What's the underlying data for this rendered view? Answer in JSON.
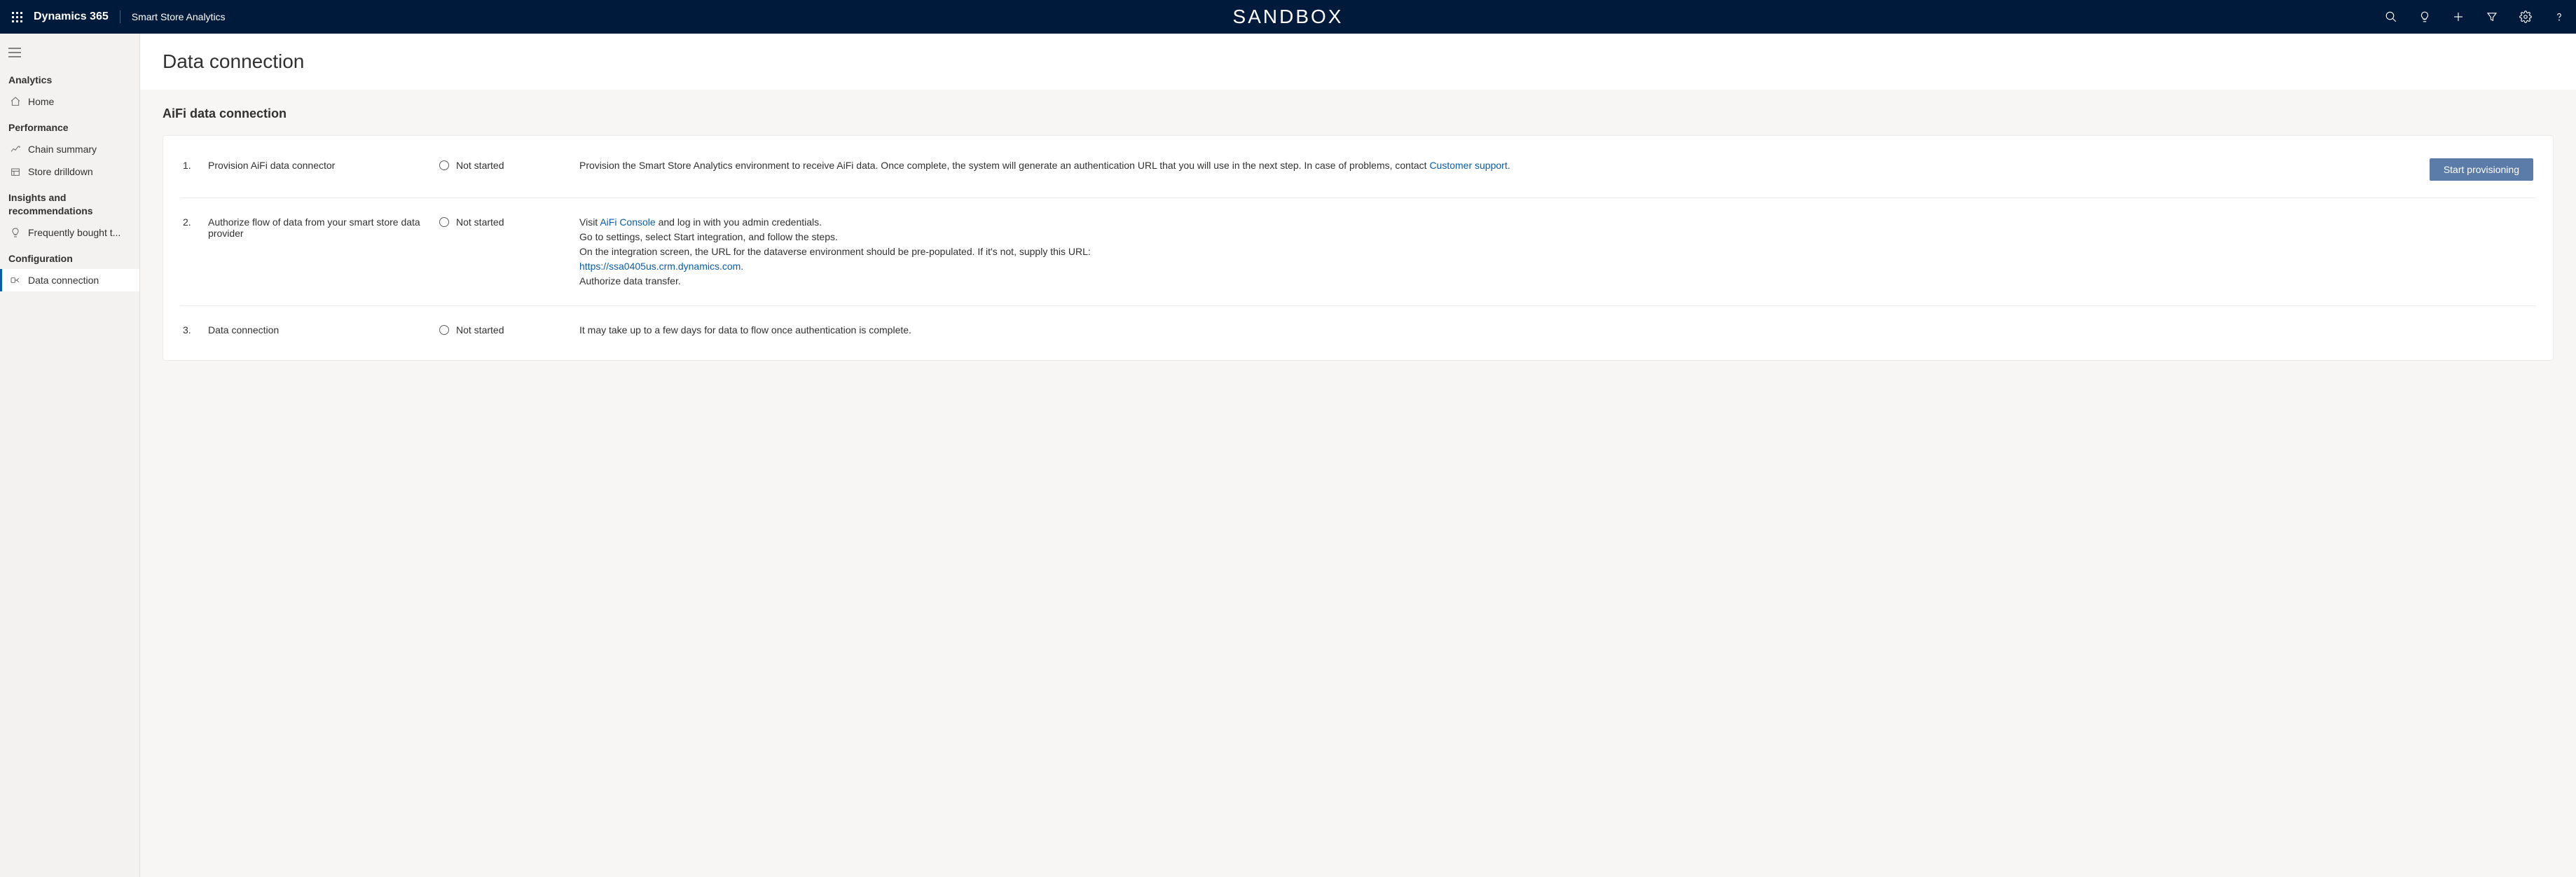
{
  "header": {
    "brand": "Dynamics 365",
    "app_name": "Smart Store Analytics",
    "env_label": "SANDBOX"
  },
  "sidebar": {
    "sections": [
      {
        "title": "Analytics",
        "items": [
          {
            "label": "Home",
            "icon": "home",
            "name": "sidebar-item-home"
          }
        ]
      },
      {
        "title": "Performance",
        "items": [
          {
            "label": "Chain summary",
            "icon": "chart-line",
            "name": "sidebar-item-chain-summary"
          },
          {
            "label": "Store drilldown",
            "icon": "store",
            "name": "sidebar-item-store-drilldown"
          }
        ]
      },
      {
        "title": "Insights and recommendations",
        "items": [
          {
            "label": "Frequently bought t...",
            "icon": "lightbulb",
            "name": "sidebar-item-frequently-bought"
          }
        ]
      },
      {
        "title": "Configuration",
        "items": [
          {
            "label": "Data connection",
            "icon": "connection",
            "name": "sidebar-item-data-connection",
            "active": true
          }
        ]
      }
    ]
  },
  "page": {
    "title": "Data connection",
    "subheading": "AiFi data connection"
  },
  "steps": [
    {
      "num": "1.",
      "title": "Provision AiFi data connector",
      "status": "Not started",
      "desc_before": "Provision the Smart Store Analytics environment to receive AiFi data. Once complete, the system will generate an authentication URL that you will use in the next step. In case of problems, contact ",
      "link1_text": "Customer support.",
      "action_label": "Start provisioning"
    },
    {
      "num": "2.",
      "title": "Authorize flow of data from your smart store data provider",
      "status": "Not started",
      "line1_before": "Visit ",
      "line1_link": "AiFi Console",
      "line1_after": " and log in with you admin credentials.",
      "line2": "Go to settings, select Start integration, and follow the steps.",
      "line3": "On the integration screen, the URL for the dataverse environment should be pre-populated. If it's not, supply this URL:",
      "line4_link": "https://ssa0405us.crm.dynamics.com.",
      "line5": "Authorize data transfer."
    },
    {
      "num": "3.",
      "title": "Data connection",
      "status": "Not started",
      "desc": "It may take up to a few days for data to flow once authentication is complete."
    }
  ]
}
